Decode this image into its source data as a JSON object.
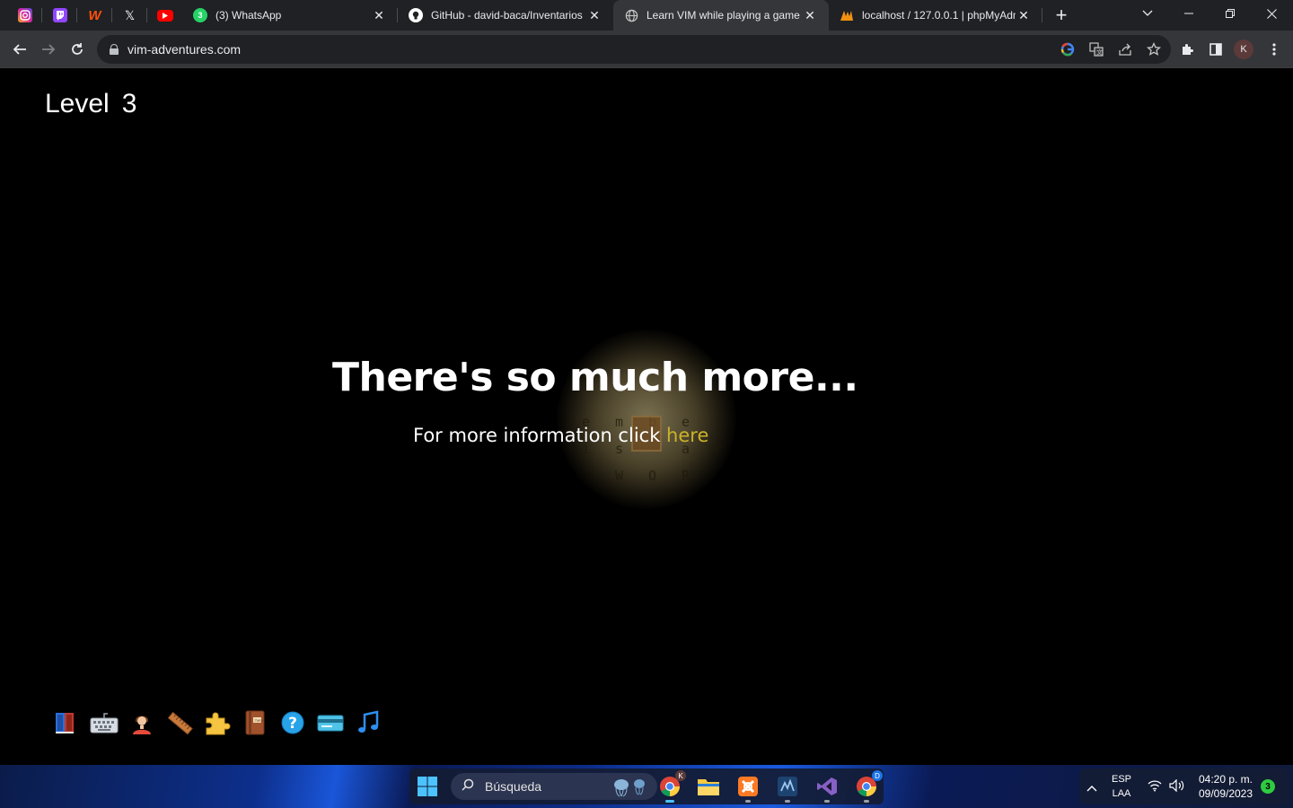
{
  "browser": {
    "pinned_tabs": [
      {
        "name": "instagram",
        "color": "#d6249f"
      },
      {
        "name": "twitch",
        "color": "#9146ff"
      },
      {
        "name": "wattpad",
        "color": "#ff500a"
      },
      {
        "name": "x",
        "color": "#ffffff"
      },
      {
        "name": "youtube",
        "color": "#ff0000"
      }
    ],
    "tabs": [
      {
        "title": "(3) WhatsApp",
        "icon": "whatsapp-icon"
      },
      {
        "title": "GitHub - david-baca/Inventarios",
        "icon": "github-icon"
      },
      {
        "title": "Learn VIM while playing a game",
        "icon": "globe-icon",
        "active": true
      },
      {
        "title": "localhost / 127.0.0.1 | phpMyAdm",
        "icon": "phpmyadmin-icon"
      }
    ],
    "url": "vim-adventures.com",
    "profile_initial": "K"
  },
  "page": {
    "level_label": "Level",
    "level_number": "3",
    "headline": "There's so much more...",
    "subtext": "For more information click",
    "link_text": "here",
    "grid_rows": [
      [
        "e",
        "m",
        "b",
        "e",
        "r"
      ],
      [
        "i",
        "s",
        "",
        "a",
        "r"
      ],
      [
        "",
        "W",
        "O",
        "R",
        ""
      ]
    ],
    "inventory": [
      "book-icon",
      "keyboard-icon",
      "person-icon",
      "ruler-icon",
      "puzzle-icon",
      "tome-icon",
      "help-icon",
      "card-icon",
      "music-icon"
    ]
  },
  "taskbar": {
    "search_placeholder": "Búsqueda",
    "lang_top": "ESP",
    "lang_bottom": "LAA",
    "time": "04:20 p. m.",
    "date": "09/09/2023",
    "notification_count": "3",
    "chrome_profile_k": "K",
    "chrome_profile_d": "D"
  }
}
